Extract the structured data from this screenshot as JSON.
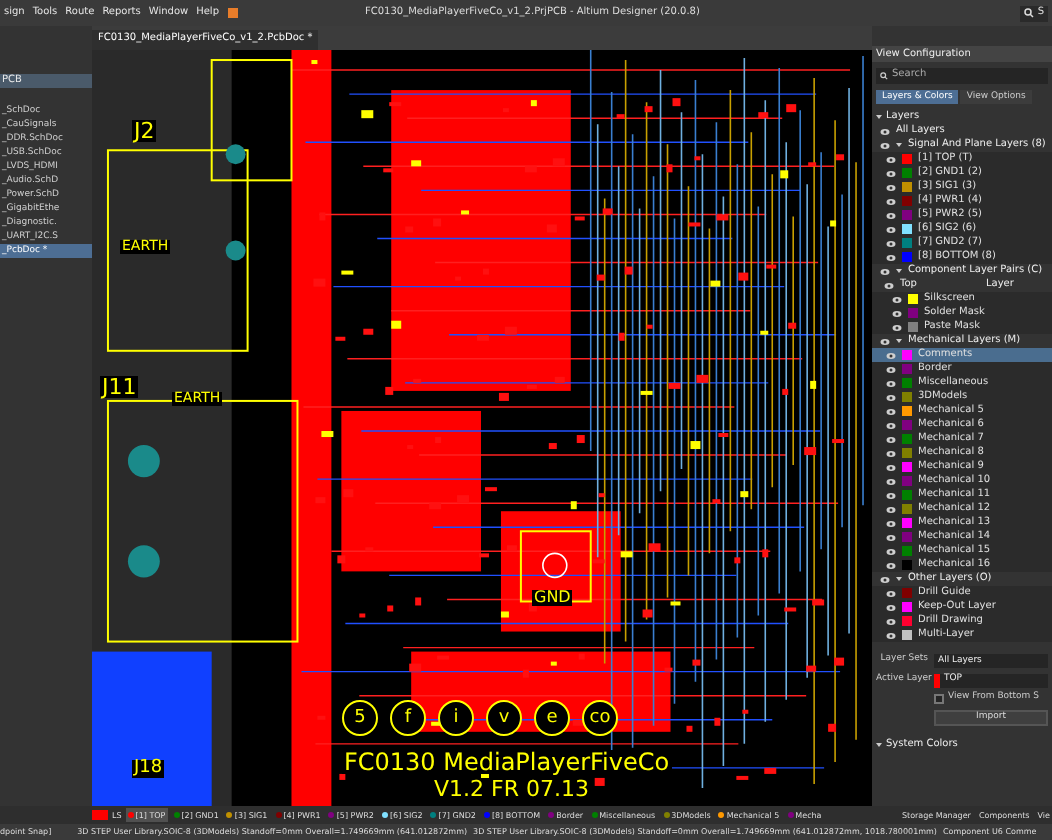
{
  "menu": [
    "sign",
    "Tools",
    "Route",
    "Reports",
    "Window",
    "Help"
  ],
  "window": {
    "title": "FC0130_MediaPlayerFiveCo_v1_2.PrjPCB - Altium Designer (20.0.8)",
    "search": "S"
  },
  "projects": {
    "header": "PCB",
    "items": [
      {
        "label": "_SchDoc",
        "selected": false
      },
      {
        "label": "_CauSignals",
        "selected": false
      },
      {
        "label": "_DDR.SchDoc",
        "selected": false
      },
      {
        "label": "_USB.SchDoc",
        "selected": false
      },
      {
        "label": "_LVDS_HDMI",
        "selected": false
      },
      {
        "label": "_Audio.SchD",
        "selected": false
      },
      {
        "label": "_Power.SchD",
        "selected": false
      },
      {
        "label": "_GigabitEthe",
        "selected": false
      },
      {
        "label": "_Diagnostic.",
        "selected": false
      },
      {
        "label": "_UART_I2C.S",
        "selected": false
      },
      {
        "label": "_PcbDoc *",
        "selected": true
      }
    ]
  },
  "document_tab": {
    "label": "FC0130_MediaPlayerFiveCo_v1_2.PcbDoc *",
    "selected": true
  },
  "board_labels": [
    "J2",
    "EARTH",
    "J11",
    "EARTH",
    "GND",
    "J18",
    "FC0130 MediaPlayerFiveCo",
    "V1.2 FR 07.13"
  ],
  "logo_letters": [
    "5",
    "f",
    "i",
    "v",
    "e",
    "co"
  ],
  "view_configuration": {
    "title": "View Configuration",
    "search": {
      "placeholder": "Search"
    },
    "tabs": [
      {
        "label": "Layers & Colors",
        "selected": true
      },
      {
        "label": "View Options",
        "selected": false
      }
    ],
    "section": "Layers",
    "all_layers": "All Layers",
    "groups": [
      {
        "name": "Signal And Plane Layers (8)",
        "kind": "list",
        "items": [
          {
            "name": "[1] TOP (T)",
            "color": "#ff0000",
            "selected": false
          },
          {
            "name": "[2] GND1 (2)",
            "color": "#008000",
            "selected": false
          },
          {
            "name": "[3] SIG1 (3)",
            "color": "#c09000",
            "selected": false
          },
          {
            "name": "[4] PWR1 (4)",
            "color": "#800000",
            "selected": false
          },
          {
            "name": "[5] PWR2 (5)",
            "color": "#800080",
            "selected": false
          },
          {
            "name": "[6] SIG2 (6)",
            "color": "#80e0ff",
            "selected": false
          },
          {
            "name": "[7] GND2 (7)",
            "color": "#008080",
            "selected": false
          },
          {
            "name": "[8] BOTTOM (8)",
            "color": "#0000ff",
            "selected": false
          }
        ]
      },
      {
        "name": "Component Layer Pairs (C)",
        "kind": "pairs",
        "side": "Top",
        "column": "Layer",
        "items": [
          {
            "name": "Silkscreen",
            "color": "#ffff00",
            "selected": false
          },
          {
            "name": "Solder Mask",
            "color": "#800080",
            "selected": false
          },
          {
            "name": "Paste Mask",
            "color": "#808080",
            "selected": false
          }
        ]
      },
      {
        "name": "Mechanical Layers (M)",
        "kind": "list",
        "items": [
          {
            "name": "Comments",
            "color": "#ff00ff",
            "selected": true
          },
          {
            "name": "Border",
            "color": "#800080",
            "selected": false
          },
          {
            "name": "Miscellaneous",
            "color": "#008000",
            "selected": false
          },
          {
            "name": "3DModels",
            "color": "#808000",
            "selected": false
          },
          {
            "name": "Mechanical 5",
            "color": "#ff9900",
            "selected": false
          },
          {
            "name": "Mechanical 6",
            "color": "#800080",
            "selected": false
          },
          {
            "name": "Mechanical 7",
            "color": "#008000",
            "selected": false
          },
          {
            "name": "Mechanical 8",
            "color": "#808000",
            "selected": false
          },
          {
            "name": "Mechanical 9",
            "color": "#ff00ff",
            "selected": false
          },
          {
            "name": "Mechanical 10",
            "color": "#800080",
            "selected": false
          },
          {
            "name": "Mechanical 11",
            "color": "#008000",
            "selected": false
          },
          {
            "name": "Mechanical 12",
            "color": "#808000",
            "selected": false
          },
          {
            "name": "Mechanical 13",
            "color": "#ff00ff",
            "selected": false
          },
          {
            "name": "Mechanical 14",
            "color": "#800080",
            "selected": false
          },
          {
            "name": "Mechanical 15",
            "color": "#008000",
            "selected": false
          },
          {
            "name": "Mechanical 16",
            "color": "#000000",
            "selected": false
          }
        ]
      },
      {
        "name": "Other Layers (O)",
        "kind": "list",
        "items": [
          {
            "name": "Drill Guide",
            "color": "#800000",
            "selected": false
          },
          {
            "name": "Keep-Out Layer",
            "color": "#ff00ff",
            "selected": false
          },
          {
            "name": "Drill Drawing",
            "color": "#ff0030",
            "selected": false
          },
          {
            "name": "Multi-Layer",
            "color": "#c0c0c0",
            "selected": false
          }
        ]
      }
    ],
    "layer_sets": {
      "label": "Layer Sets",
      "value": "All Layers"
    },
    "active_layer": {
      "label": "Active Layer",
      "value": "TOP",
      "color": "#ff0000"
    },
    "view_from_bottom": {
      "label": "View From Bottom S",
      "checked": false
    },
    "import_button": "Import",
    "system_colors": "System Colors"
  },
  "layer_bar": {
    "ls": "LS",
    "tabs": [
      {
        "label": "[1] TOP",
        "color": "#ff0000",
        "selected": true
      },
      {
        "label": "[2] GND1",
        "color": "#008000",
        "selected": false
      },
      {
        "label": "[3] SIG1",
        "color": "#c09000",
        "selected": false
      },
      {
        "label": "[4] PWR1",
        "color": "#800000",
        "selected": false
      },
      {
        "label": "[5] PWR2",
        "color": "#800080",
        "selected": false
      },
      {
        "label": "[6] SIG2",
        "color": "#80e0ff",
        "selected": false
      },
      {
        "label": "[7] GND2",
        "color": "#008080",
        "selected": false
      },
      {
        "label": "[8] BOTTOM",
        "color": "#0000ff",
        "selected": false
      },
      {
        "label": "Border",
        "color": "#800080",
        "selected": false
      },
      {
        "label": "Miscellaneous",
        "color": "#008000",
        "selected": false
      },
      {
        "label": "3DModels",
        "color": "#808000",
        "selected": false
      },
      {
        "label": "Mechanical 5",
        "color": "#ff9900",
        "selected": false
      },
      {
        "label": "Mecha",
        "color": "#800080",
        "selected": false
      }
    ],
    "panels": [
      "Storage Manager",
      "Components",
      "Vie"
    ]
  },
  "status_bar": [
    "dpoint Snap]",
    "3D STEP User Library.SOIC-8 (3DModels)  Standoff=0mm  Overall=1.749669mm  (641.012872mm)",
    "3D STEP User Library.SOIC-8 (3DModels)  Standoff=0mm  Overall=1.749669mm  (641.012872mm, 1018.780001mm)",
    "Component U6 Comme"
  ]
}
